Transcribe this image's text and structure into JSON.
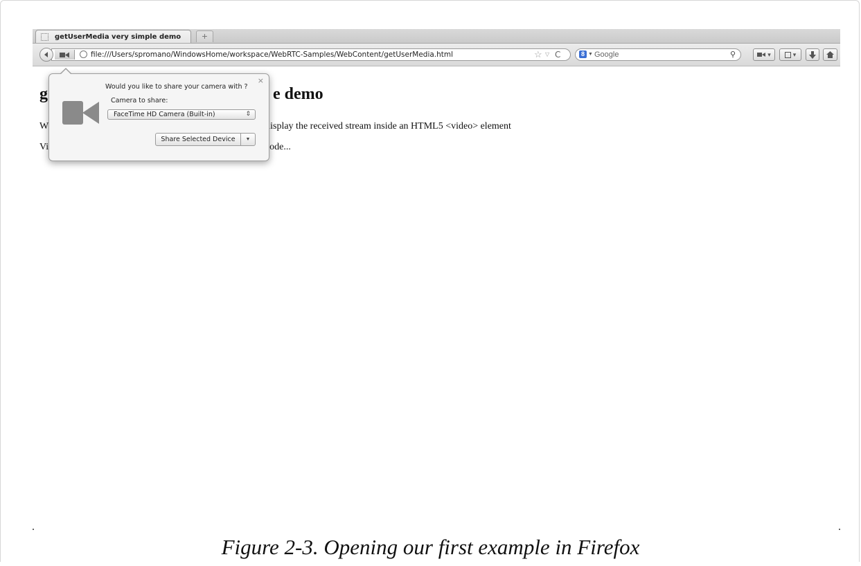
{
  "browser": {
    "tab_title": "getUserMedia very simple demo",
    "new_tab_symbol": "+",
    "url": "file:///Users/spromano/WindowsHome/workspace/WebRTC-Samples/WebContent/getUserMedia.html",
    "search_engine_letter": "8",
    "search_placeholder": "Google",
    "reload_symbol": "C",
    "star_symbol": "☆",
    "dropdown_symbol": "▽"
  },
  "page": {
    "heading_left": "g",
    "heading_right": "e demo",
    "para1_left": "W",
    "para1_right": "lisplay the received stream inside an HTML5 <video> element",
    "para2_left": "Vi",
    "para2_right": "ode..."
  },
  "popup": {
    "close_symbol": "×",
    "question": "Would you like to share your camera with ?",
    "camera_label": "Camera to share:",
    "selected_camera": "FaceTime HD Camera (Built-in)",
    "share_button_label": "Share Selected Device",
    "camera_icon_color": "#8a8a8a"
  },
  "caption": "Figure 2-3. Opening our first example in Firefox"
}
